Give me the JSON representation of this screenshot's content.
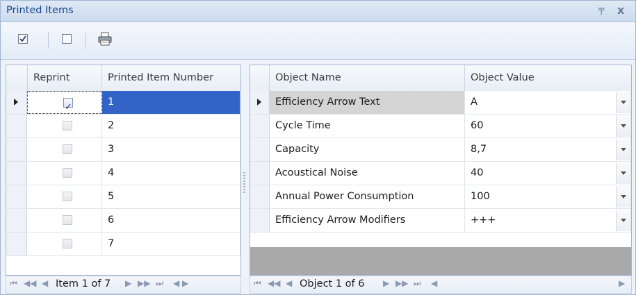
{
  "panel": {
    "title": "Printed Items",
    "pin": "ߵ",
    "close": "x"
  },
  "left_grid": {
    "headers": [
      "Reprint",
      "Printed Item Number"
    ],
    "rows": [
      {
        "number": "1",
        "checked": true
      },
      {
        "number": "2",
        "checked": false
      },
      {
        "number": "3",
        "checked": false
      },
      {
        "number": "4",
        "checked": false
      },
      {
        "number": "5",
        "checked": false
      },
      {
        "number": "6",
        "checked": false
      },
      {
        "number": "7",
        "checked": false
      }
    ],
    "nav_text": "Item 1 of 7"
  },
  "right_grid": {
    "headers": [
      "Object Name",
      "Object Value"
    ],
    "rows": [
      {
        "name": "Efficiency Arrow Text",
        "value": "A"
      },
      {
        "name": "Cycle Time",
        "value": "60"
      },
      {
        "name": "Capacity",
        "value": "8,7"
      },
      {
        "name": "Acoustical Noise",
        "value": "40"
      },
      {
        "name": "Annual Power Consumption",
        "value": "100"
      },
      {
        "name": "Efficiency Arrow Modifiers",
        "value": "+++"
      }
    ],
    "nav_text": "Object 1 of 6"
  },
  "nav_glyphs": {
    "first": "⏮",
    "prev_page": "◀◀",
    "prev": "◀",
    "next": "▶",
    "next_page": "▶▶",
    "last": "⏭"
  },
  "colors": {
    "selection": "#3264c8",
    "current_row": "#d4d4d4",
    "title_text": "#15428b"
  },
  "icons": [
    "check-all-icon",
    "uncheck-all-icon",
    "print-icon",
    "pin-icon",
    "close-icon"
  ]
}
